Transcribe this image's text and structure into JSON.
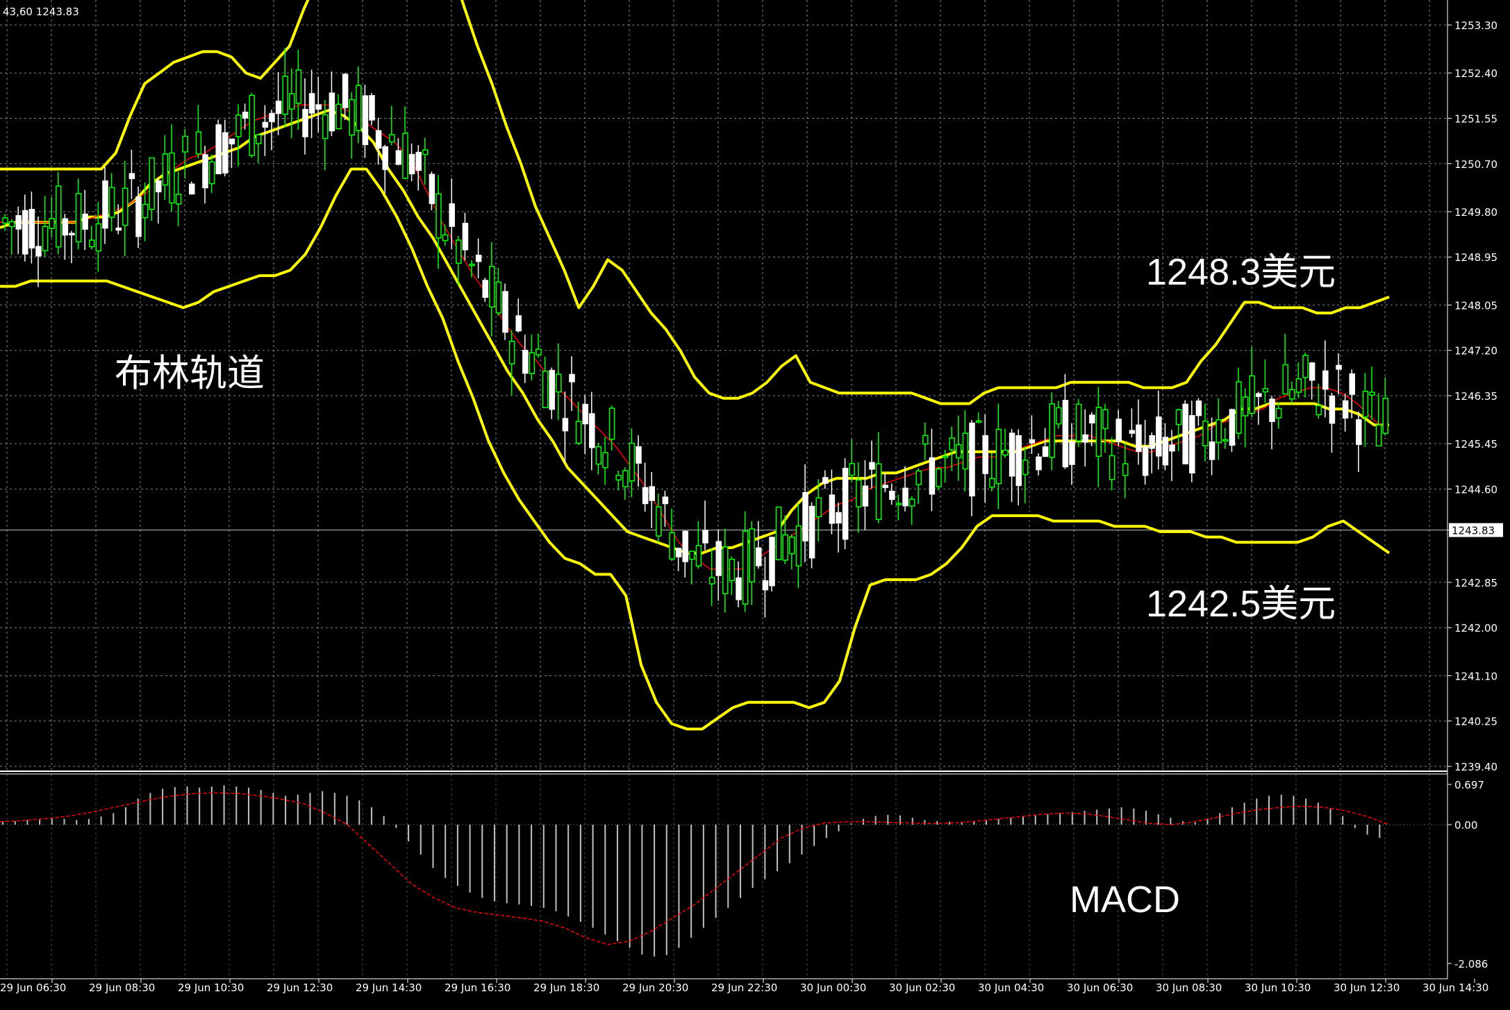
{
  "chart_data": [
    {
      "type": "candlestick",
      "panel": "price",
      "header": "43,60 1243.83",
      "y_ticks": [
        "1253.30",
        "1252.40",
        "1251.55",
        "1250.70",
        "1249.80",
        "1248.95",
        "1248.05",
        "1247.20",
        "1246.35",
        "1245.45",
        "1244.60",
        "1243.83",
        "1242.85",
        "1242.00",
        "1241.10",
        "1240.25",
        "1239.40"
      ],
      "ylim": [
        1239.4,
        1253.3
      ],
      "current_price_label": "1243.83",
      "current_price": 1243.83,
      "x_ticks": [
        "29 Jun 06:30",
        "29 Jun 08:30",
        "29 Jun 10:30",
        "29 Jun 12:30",
        "29 Jun 14:30",
        "29 Jun 16:30",
        "29 Jun 18:30",
        "29 Jun 20:30",
        "29 Jun 22:30",
        "30 Jun 00:30",
        "30 Jun 02:30",
        "30 Jun 04:30",
        "30 Jun 06:30",
        "30 Jun 08:30",
        "30 Jun 10:30",
        "30 Jun 12:30",
        "30 Jun 14:30"
      ],
      "annotations": {
        "bollinger_label": "布林轨道",
        "upper_label": "1248.3美元",
        "lower_label": "1242.5美元"
      },
      "colors": {
        "bull": "#00ff00",
        "bear": "#ffffff",
        "bands": "#ffff00",
        "ma": "#ff0000",
        "grid": "#7a8a8a",
        "background": "#000000"
      },
      "series": [
        {
          "name": "upper_band",
          "values": [
            1250.6,
            1250.6,
            1250.6,
            1250.6,
            1250.6,
            1250.6,
            1250.6,
            1250.6,
            1250.9,
            1251.6,
            1252.2,
            1252.4,
            1252.6,
            1252.7,
            1252.8,
            1252.8,
            1252.7,
            1252.4,
            1252.3,
            1252.6,
            1252.9,
            1253.6,
            1254.2,
            1254.6,
            1254.6,
            1254.6,
            1254.6,
            1254.6,
            1254.6,
            1254.6,
            1254.6,
            1254.6,
            1253.7,
            1252.9,
            1252.2,
            1251.4,
            1250.7,
            1249.9,
            1249.3,
            1248.7,
            1248.0,
            1248.4,
            1248.9,
            1248.7,
            1248.3,
            1247.9,
            1247.6,
            1247.2,
            1246.7,
            1246.4,
            1246.3,
            1246.3,
            1246.4,
            1246.6,
            1246.9,
            1247.1,
            1246.6,
            1246.5,
            1246.4,
            1246.4,
            1246.4,
            1246.4,
            1246.4,
            1246.4,
            1246.3,
            1246.2,
            1246.2,
            1246.2,
            1246.4,
            1246.5,
            1246.5,
            1246.5,
            1246.5,
            1246.5,
            1246.6,
            1246.6,
            1246.6,
            1246.6,
            1246.6,
            1246.5,
            1246.5,
            1246.5,
            1246.6,
            1247.0,
            1247.3,
            1247.7,
            1248.1,
            1248.1,
            1248.0,
            1248.0,
            1248.0,
            1247.9,
            1247.9,
            1248.0,
            1248.0,
            1248.1,
            1248.2
          ]
        },
        {
          "name": "middle_band",
          "values": [
            1249.5,
            1249.6,
            1249.6,
            1249.6,
            1249.6,
            1249.6,
            1249.7,
            1249.7,
            1249.8,
            1250.0,
            1250.3,
            1250.5,
            1250.6,
            1250.7,
            1250.8,
            1250.9,
            1251.0,
            1251.2,
            1251.3,
            1251.4,
            1251.5,
            1251.6,
            1251.7,
            1251.6,
            1251.4,
            1251.1,
            1250.6,
            1250.2,
            1249.7,
            1249.3,
            1248.8,
            1248.3,
            1247.8,
            1247.3,
            1246.8,
            1246.4,
            1245.9,
            1245.5,
            1245.0,
            1244.7,
            1244.4,
            1244.1,
            1243.8,
            1243.7,
            1243.6,
            1243.5,
            1243.4,
            1243.4,
            1243.5,
            1243.5,
            1243.6,
            1243.7,
            1243.8,
            1244.2,
            1244.5,
            1244.7,
            1244.8,
            1244.8,
            1244.8,
            1244.9,
            1244.9,
            1245.0,
            1245.1,
            1245.2,
            1245.3,
            1245.3,
            1245.3,
            1245.3,
            1245.3,
            1245.4,
            1245.5,
            1245.5,
            1245.5,
            1245.5,
            1245.5,
            1245.5,
            1245.4,
            1245.4,
            1245.5,
            1245.6,
            1245.7,
            1245.8,
            1245.9,
            1246.1,
            1246.1,
            1246.2,
            1246.2,
            1246.2,
            1246.2,
            1246.1,
            1246.1,
            1246.0,
            1245.8,
            1245.8
          ]
        },
        {
          "name": "lower_band",
          "values": [
            1248.4,
            1248.4,
            1248.5,
            1248.5,
            1248.5,
            1248.5,
            1248.5,
            1248.5,
            1248.4,
            1248.3,
            1248.2,
            1248.1,
            1248.0,
            1248.1,
            1248.3,
            1248.4,
            1248.5,
            1248.6,
            1248.6,
            1248.7,
            1249.0,
            1249.5,
            1250.1,
            1250.6,
            1250.6,
            1250.2,
            1249.7,
            1249.1,
            1248.4,
            1247.8,
            1247.0,
            1246.3,
            1245.5,
            1244.9,
            1244.4,
            1244.0,
            1243.6,
            1243.3,
            1243.2,
            1243.0,
            1243.0,
            1242.6,
            1241.3,
            1240.6,
            1240.2,
            1240.1,
            1240.1,
            1240.3,
            1240.5,
            1240.6,
            1240.6,
            1240.6,
            1240.6,
            1240.5,
            1240.6,
            1241.0,
            1242.0,
            1242.8,
            1242.9,
            1242.9,
            1242.9,
            1243.0,
            1243.2,
            1243.5,
            1243.9,
            1244.1,
            1244.1,
            1244.1,
            1244.1,
            1244.0,
            1244.0,
            1244.0,
            1244.0,
            1243.9,
            1243.9,
            1243.9,
            1243.8,
            1243.8,
            1243.8,
            1243.7,
            1243.7,
            1243.6,
            1243.6,
            1243.6,
            1243.6,
            1243.6,
            1243.7,
            1243.9,
            1244.0,
            1243.8,
            1243.6,
            1243.4
          ]
        },
        {
          "name": "ma_red",
          "values": [
            1249.6,
            1249.6,
            1249.6,
            1249.6,
            1249.6,
            1249.6,
            1249.7,
            1249.8,
            1249.9,
            1250.1,
            1250.3,
            1250.6,
            1250.8,
            1250.9,
            1251.1,
            1251.3,
            1251.5,
            1251.6,
            1251.7,
            1251.8,
            1251.8,
            1251.8,
            1251.7,
            1251.5,
            1251.3,
            1251.1,
            1250.8,
            1250.2,
            1249.6,
            1249.1,
            1248.6,
            1248.2,
            1247.7,
            1247.3,
            1247.0,
            1246.6,
            1246.3,
            1246.0,
            1245.7,
            1245.4,
            1245.0,
            1244.6,
            1244.1,
            1243.6,
            1243.3,
            1243.1,
            1243.1,
            1243.1,
            1243.3,
            1243.5,
            1243.7,
            1243.9,
            1244.1,
            1244.3,
            1244.4,
            1244.6,
            1244.7,
            1244.8,
            1244.9,
            1245.0,
            1245.0,
            1245.1,
            1245.2,
            1245.2,
            1245.3,
            1245.4,
            1245.5,
            1245.6,
            1245.6,
            1245.6,
            1245.5,
            1245.4,
            1245.3,
            1245.3,
            1245.4,
            1245.5,
            1245.6,
            1245.8,
            1245.9,
            1246.0,
            1246.1,
            1246.3,
            1246.4,
            1246.5,
            1246.5,
            1246.4,
            1246.2,
            1245.9,
            1245.7
          ]
        }
      ]
    },
    {
      "type": "bar",
      "panel": "indicator",
      "title": "MACD",
      "y_ticks": [
        "0.697",
        "0.00",
        "-2.086"
      ],
      "ylim": [
        -2.086,
        0.697
      ],
      "colors": {
        "histogram": "#c0c0c0",
        "signal": "#ff0000"
      },
      "series": [
        {
          "name": "histogram",
          "values": [
            0.05,
            0.06,
            0.08,
            0.1,
            0.12,
            0.1,
            0.08,
            0.1,
            0.14,
            0.2,
            0.3,
            0.45,
            0.55,
            0.62,
            0.65,
            0.66,
            0.64,
            0.66,
            0.68,
            0.66,
            0.64,
            0.6,
            0.55,
            0.5,
            0.52,
            0.55,
            0.58,
            0.55,
            0.5,
            0.42,
            0.3,
            0.15,
            -0.05,
            -0.25,
            -0.45,
            -0.65,
            -0.8,
            -0.92,
            -1.02,
            -1.1,
            -1.15,
            -1.18,
            -1.2,
            -1.22,
            -1.25,
            -1.3,
            -1.38,
            -1.46,
            -1.55,
            -1.65,
            -1.75,
            -1.85,
            -1.95,
            -1.98,
            -1.96,
            -1.85,
            -1.7,
            -1.55,
            -1.4,
            -1.25,
            -1.1,
            -0.95,
            -0.82,
            -0.7,
            -0.58,
            -0.45,
            -0.32,
            -0.2,
            -0.1,
            0.02,
            0.1,
            0.15,
            0.17,
            0.16,
            0.12,
            0.08,
            0.06,
            0.05,
            0.05,
            0.06,
            0.08,
            0.1,
            0.12,
            0.14,
            0.16,
            0.18,
            0.2,
            0.22,
            0.24,
            0.26,
            0.28,
            0.3,
            0.28,
            0.24,
            0.18,
            0.12,
            0.06,
            0.04,
            0.1,
            0.2,
            0.3,
            0.38,
            0.45,
            0.5,
            0.52,
            0.5,
            0.45,
            0.38,
            0.28,
            0.15,
            -0.05,
            -0.15,
            -0.2
          ]
        },
        {
          "name": "signal",
          "values": [
            0.05,
            0.07,
            0.1,
            0.14,
            0.2,
            0.28,
            0.36,
            0.44,
            0.5,
            0.54,
            0.55,
            0.54,
            0.5,
            0.44,
            0.36,
            0.2,
            0.0,
            -0.3,
            -0.6,
            -0.9,
            -1.1,
            -1.25,
            -1.32,
            -1.36,
            -1.4,
            -1.45,
            -1.55,
            -1.7,
            -1.8,
            -1.75,
            -1.6,
            -1.4,
            -1.2,
            -0.95,
            -0.7,
            -0.45,
            -0.2,
            -0.05,
            0.03,
            0.05,
            0.05,
            0.04,
            0.03,
            0.02,
            0.03,
            0.06,
            0.1,
            0.14,
            0.18,
            0.2,
            0.19,
            0.14,
            0.08,
            0.02,
            0.0,
            0.05,
            0.12,
            0.2,
            0.26,
            0.3,
            0.32,
            0.3,
            0.24,
            0.14,
            0.0
          ]
        }
      ]
    }
  ]
}
